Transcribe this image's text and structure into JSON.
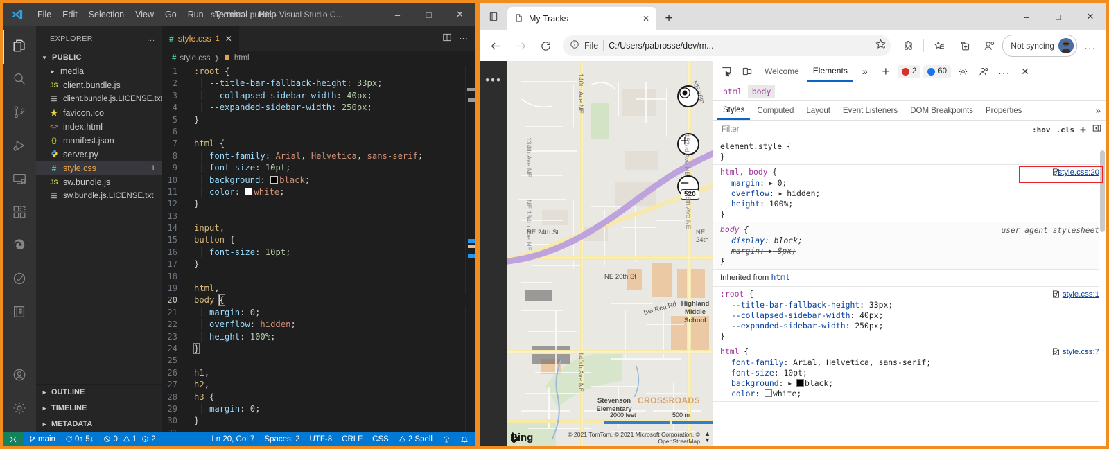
{
  "vscode": {
    "window_title": "style.css - public - Visual Studio C...",
    "menu": [
      "File",
      "Edit",
      "Selection",
      "View",
      "Go",
      "Run",
      "Terminal",
      "Help"
    ],
    "window_buttons": [
      "minimize",
      "maximize",
      "close"
    ],
    "activity_bar": [
      {
        "name": "explorer",
        "icon": "files-icon",
        "active": true
      },
      {
        "name": "search",
        "icon": "search-icon",
        "active": false
      },
      {
        "name": "source-control",
        "icon": "source-control-icon",
        "active": false
      },
      {
        "name": "run-and-debug",
        "icon": "run-debug-icon",
        "active": false
      },
      {
        "name": "remote-explorer",
        "icon": "remote-explorer-icon",
        "active": false
      },
      {
        "name": "extensions",
        "icon": "extensions-icon",
        "active": false
      },
      {
        "name": "edge-tools",
        "icon": "edge-icon",
        "active": false
      },
      {
        "name": "testing",
        "icon": "testing-icon",
        "active": false
      },
      {
        "name": "notebook",
        "icon": "notebook-icon",
        "active": false
      }
    ],
    "activity_bar_bottom": [
      {
        "name": "accounts",
        "icon": "account-icon"
      },
      {
        "name": "settings",
        "icon": "gear-icon"
      }
    ],
    "explorer": {
      "title": "EXPLORER",
      "more_actions": "...",
      "root_label": "PUBLIC",
      "items": [
        {
          "label": "media",
          "icon": "folder",
          "type": "folder",
          "badge": ""
        },
        {
          "label": "client.bundle.js",
          "icon": "JS",
          "type": "js",
          "badge": ""
        },
        {
          "label": "client.bundle.js.LICENSE.txt",
          "icon": "txt",
          "type": "txt",
          "badge": ""
        },
        {
          "label": "favicon.ico",
          "icon": "star",
          "type": "ico",
          "badge": ""
        },
        {
          "label": "index.html",
          "icon": "<>",
          "type": "html",
          "badge": ""
        },
        {
          "label": "manifest.json",
          "icon": "{}",
          "type": "json",
          "badge": ""
        },
        {
          "label": "server.py",
          "icon": "py",
          "type": "py",
          "badge": ""
        },
        {
          "label": "style.css",
          "icon": "#",
          "type": "css",
          "badge": "1",
          "selected": true
        },
        {
          "label": "sw.bundle.js",
          "icon": "JS",
          "type": "js",
          "badge": ""
        },
        {
          "label": "sw.bundle.js.LICENSE.txt",
          "icon": "txt",
          "type": "txt",
          "badge": ""
        }
      ],
      "bottom_sections": [
        "OUTLINE",
        "TIMELINE",
        "METADATA"
      ]
    },
    "editor": {
      "tab": {
        "icon": "#",
        "label": "style.css",
        "count": "1",
        "close": "✕"
      },
      "tab_actions": [
        "split-editor",
        "more-actions"
      ],
      "breadcrumb": [
        {
          "icon": "#",
          "label": "style.css"
        },
        {
          "icon": "tag",
          "label": "html"
        }
      ],
      "lines": [
        {
          "n": "1",
          "text": ":root {"
        },
        {
          "n": "2",
          "text": "  --title-bar-fallback-height: 33px;"
        },
        {
          "n": "3",
          "text": "  --collapsed-sidebar-width: 40px;"
        },
        {
          "n": "4",
          "text": "  --expanded-sidebar-width: 250px;"
        },
        {
          "n": "5",
          "text": "}"
        },
        {
          "n": "6",
          "text": ""
        },
        {
          "n": "7",
          "text": "html {"
        },
        {
          "n": "8",
          "text": "  font-family: Arial, Helvetica, sans-serif;"
        },
        {
          "n": "9",
          "text": "  font-size: 10pt;"
        },
        {
          "n": "10",
          "text": "  background: black;"
        },
        {
          "n": "11",
          "text": "  color: white;"
        },
        {
          "n": "12",
          "text": "}"
        },
        {
          "n": "13",
          "text": ""
        },
        {
          "n": "14",
          "text": "input,"
        },
        {
          "n": "15",
          "text": "button {"
        },
        {
          "n": "16",
          "text": "  font-size: 10pt;"
        },
        {
          "n": "17",
          "text": "}"
        },
        {
          "n": "18",
          "text": ""
        },
        {
          "n": "19",
          "text": "html,"
        },
        {
          "n": "20",
          "text": "body {"
        },
        {
          "n": "21",
          "text": "  margin: 0;"
        },
        {
          "n": "22",
          "text": "  overflow: hidden;"
        },
        {
          "n": "23",
          "text": "  height: 100%;"
        },
        {
          "n": "24",
          "text": "}"
        },
        {
          "n": "25",
          "text": ""
        },
        {
          "n": "26",
          "text": "h1,"
        },
        {
          "n": "27",
          "text": "h2,"
        },
        {
          "n": "28",
          "text": "h3 {"
        },
        {
          "n": "29",
          "text": "  margin: 0;"
        },
        {
          "n": "30",
          "text": "}"
        },
        {
          "n": "31",
          "text": ""
        }
      ]
    },
    "statusbar": {
      "remote_icon": "remote-indicator-icon",
      "branch": "main",
      "sync": "0↑ 5↓",
      "errors": "0",
      "warnings": "1",
      "infos": "2",
      "cursor": "Ln 20, Col 7",
      "spaces": "Spaces: 2",
      "encoding": "UTF-8",
      "eol": "CRLF",
      "language": "CSS",
      "spell": "2 Spell",
      "right_icons": [
        "broadcast-icon",
        "bell-icon"
      ]
    }
  },
  "browser": {
    "tab_search_icon": "tab-search-icon",
    "tabs": [
      {
        "title": "My Tracks",
        "icon": "page-icon",
        "active": true
      }
    ],
    "new_tab": "+",
    "window_buttons": [
      "minimize",
      "maximize",
      "close"
    ],
    "nav": {
      "back": "back-icon",
      "forward": "forward-icon",
      "refresh": "refresh-icon"
    },
    "omnibox": {
      "info_icon": "info-icon",
      "scheme": "File",
      "url": "C:/Users/pabrosse/dev/m...",
      "favorite_icon": "add-favorite-icon"
    },
    "toolbar_icons": [
      "extensions-icon",
      "collections-icon",
      "add-tab-group-icon",
      "browser-essentials-icon"
    ],
    "profile": {
      "label": "Not syncing",
      "avatar": "user-avatar"
    },
    "settings_more": "..."
  },
  "page": {
    "sidebar_more": "•••",
    "map": {
      "controls": [
        {
          "name": "locate-me",
          "icon": "target-icon"
        },
        {
          "name": "zoom-in",
          "icon": "plus-icon"
        },
        {
          "name": "zoom-out",
          "icon": "minus-icon"
        }
      ],
      "road_shield": "520",
      "street_labels": [
        "140th Ave NE",
        "134th Ave NE",
        "NE 134th Ave NE",
        "NE 24th St",
        "NE 20th St",
        "NE 36th",
        "152nd Ave NE",
        "148th Ave NE",
        "Bel Red Rd",
        "NE 24th",
        "140th Ave NE"
      ],
      "place_labels": [
        "Highland Middle School",
        "Stevenson Elementary",
        "CROSSROADS"
      ],
      "scale_imperial": "2000 feet",
      "scale_metric": "500 m",
      "brand": "Bing",
      "attribution": "© 2021 TomTom, © 2021 Microsoft Corporation, © OpenStreetMap"
    }
  },
  "devtools": {
    "toolbar": {
      "inspect_icon": "inspect-element-icon",
      "device_icon": "device-emulation-icon",
      "tabs": [
        {
          "label": "Welcome",
          "active": false
        },
        {
          "label": "Elements",
          "active": true
        }
      ],
      "more_tabs": "»",
      "add_tab": "+",
      "errors": "2",
      "infos": "60",
      "settings_icon": "gear-icon",
      "devtools_customize_icon": "customize-icon",
      "more_icon": "...",
      "close_icon": "✕"
    },
    "breadcrumbs": [
      {
        "label": "html",
        "selected": false
      },
      {
        "label": "body",
        "selected": true
      }
    ],
    "subtabs": [
      {
        "label": "Styles",
        "active": true
      },
      {
        "label": "Computed",
        "active": false
      },
      {
        "label": "Layout",
        "active": false
      },
      {
        "label": "Event Listeners",
        "active": false
      },
      {
        "label": "DOM Breakpoints",
        "active": false
      },
      {
        "label": "Properties",
        "active": false
      }
    ],
    "subtabs_overflow": "»",
    "filter": {
      "placeholder": "Filter",
      "hov": ":hov",
      "cls": ".cls",
      "new_rule": "+",
      "toggle_pane": "toggle-sidebar-icon"
    },
    "rules": [
      {
        "selector": "element.style",
        "source": "",
        "note": "",
        "declarations": []
      },
      {
        "selector": "html, body",
        "source": "style.css:20",
        "note": "",
        "highlighted": true,
        "declarations": [
          {
            "prop": "margin",
            "value": "0",
            "expandable": true
          },
          {
            "prop": "overflow",
            "value": "hidden",
            "expandable": true
          },
          {
            "prop": "height",
            "value": "100%",
            "expandable": false
          }
        ]
      },
      {
        "selector": "body",
        "source": "",
        "note": "user agent stylesheet",
        "ua": true,
        "declarations": [
          {
            "prop": "display",
            "value": "block",
            "expandable": false
          },
          {
            "prop": "margin",
            "value": "8px",
            "expandable": true,
            "struck": true
          }
        ]
      }
    ],
    "inherited_label": "Inherited from",
    "inherited_from": "html",
    "inherited_rules": [
      {
        "selector": ":root",
        "source": "style.css:1",
        "declarations": [
          {
            "prop": "--title-bar-fallback-height",
            "value": "33px"
          },
          {
            "prop": "--collapsed-sidebar-width",
            "value": "40px"
          },
          {
            "prop": "--expanded-sidebar-width",
            "value": "250px"
          }
        ]
      },
      {
        "selector": "html",
        "source": "style.css:7",
        "declarations": [
          {
            "prop": "font-family",
            "value": "Arial, Helvetica, sans-serif"
          },
          {
            "prop": "font-size",
            "value": "10pt"
          },
          {
            "prop": "background",
            "value": "black",
            "expandable": true,
            "swatch": "#000000"
          },
          {
            "prop": "color",
            "value": "white",
            "expandable": false,
            "swatch": "#ffffff"
          }
        ]
      }
    ]
  },
  "colors": {
    "frame_orange": "#f28c1e",
    "vscode_bg": "#1e1e1e",
    "statusbar_blue": "#0078d4",
    "highlight_red": "#e8232a",
    "devtools_link": "#0842a0"
  }
}
